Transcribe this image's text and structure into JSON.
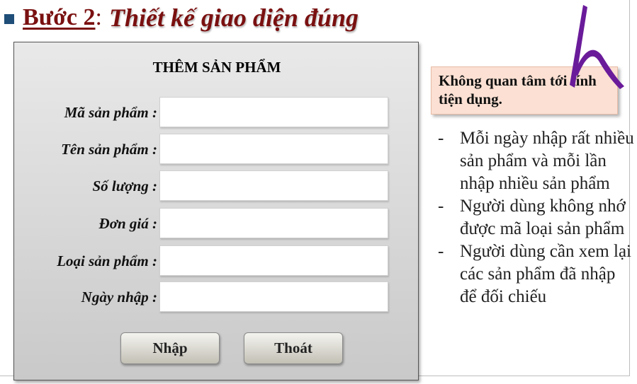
{
  "heading": {
    "step": "Bước 2",
    "colon": ":",
    "title": "Thiết kế giao diện đúng"
  },
  "form": {
    "title": "THÊM SẢN PHẨM",
    "fields": [
      {
        "label": "Mã sản phẩm :",
        "value": ""
      },
      {
        "label": "Tên sản phẩm :",
        "value": ""
      },
      {
        "label": "Số lượng :",
        "value": ""
      },
      {
        "label": "Đơn giá :",
        "value": ""
      },
      {
        "label": "Loại sản phẩm :",
        "value": ""
      },
      {
        "label": "Ngày nhập :",
        "value": ""
      }
    ],
    "submit_label": "Nhập",
    "exit_label": "Thoát"
  },
  "callout": {
    "text": "Không quan tâm tới tính tiện dụng."
  },
  "notes": {
    "dash": "-",
    "items": [
      "Mỗi ngày nhập rất nhiều sản phẩm và mỗi lần nhập nhiều sản phẩm",
      "Người dùng không nhớ được mã loại sản phẩm",
      "Người dùng cần xem lại các sản phẩm đã nhập để đối chiếu"
    ]
  },
  "colors": {
    "heading": "#7a1010",
    "bullet": "#1f4e79",
    "callout_bg": "#fbe0d3",
    "logo": "#6a1b9a"
  },
  "icons": {
    "heading_bullet": "square-bullet-icon",
    "logo": "h-logo-mark"
  }
}
